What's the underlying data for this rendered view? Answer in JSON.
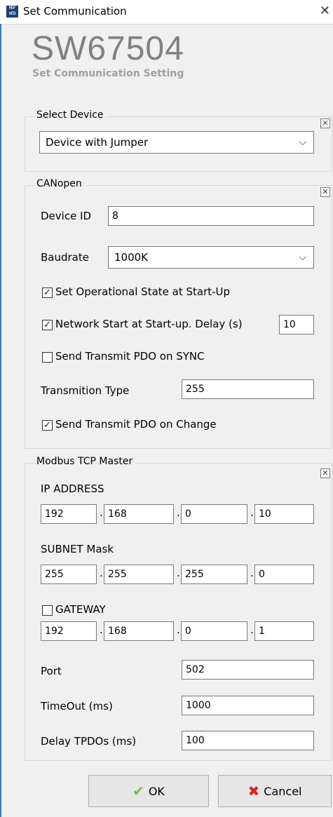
{
  "window": {
    "title": "Set Communication",
    "app_icon_text": "MDF WEB"
  },
  "brand": {
    "code": "SW67504",
    "subtitle": "Set Communication Setting"
  },
  "select_device": {
    "legend": "Select Device",
    "value": "Device with Jumper"
  },
  "canopen": {
    "legend": "CANopen",
    "device_id_label": "Device ID",
    "device_id_value": "8",
    "baudrate_label": "Baudrate",
    "baudrate_value": "1000K",
    "set_operational_label": "Set Operational State at Start-Up",
    "set_operational_checked": true,
    "network_start_label": "Network Start at Start-up. Delay (s)",
    "network_start_checked": true,
    "network_start_delay": "10",
    "send_tpdo_sync_label": "Send Transmit PDO on SYNC",
    "send_tpdo_sync_checked": false,
    "transmition_type_label": "Transmition Type",
    "transmition_type_value": "255",
    "send_tpdo_change_label": "Send Transmit PDO on Change",
    "send_tpdo_change_checked": true
  },
  "modbus": {
    "legend": "Modbus TCP Master",
    "ip_label": "IP ADDRESS",
    "ip": [
      "192",
      "168",
      "0",
      "10"
    ],
    "subnet_label": "SUBNET Mask",
    "subnet": [
      "255",
      "255",
      "255",
      "0"
    ],
    "gateway_label": "GATEWAY",
    "gateway_checked": false,
    "gateway": [
      "192",
      "168",
      "0",
      "1"
    ],
    "port_label": "Port",
    "port_value": "502",
    "timeout_label": "TimeOut (ms)",
    "timeout_value": "1000",
    "delay_label": "Delay TPDOs (ms)",
    "delay_value": "100"
  },
  "buttons": {
    "ok": "OK",
    "cancel": "Cancel"
  },
  "icons": {
    "checkmark": "✓",
    "collapse": "☒",
    "ok_icon": "green-check",
    "cancel_icon": "red-x"
  },
  "colors": {
    "ok_icon": "#6fbf3b",
    "cancel_icon": "#d9261c",
    "window_accent": "#2d7fc1"
  }
}
